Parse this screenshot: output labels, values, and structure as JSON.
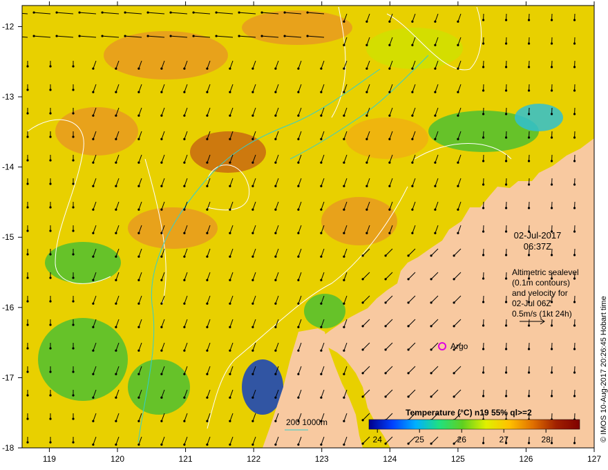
{
  "map": {
    "lon_range": [
      118.6,
      127.0
    ],
    "lat_range": [
      -18.0,
      -11.7
    ],
    "lon_ticks": [
      "119",
      "120",
      "121",
      "122",
      "123",
      "124",
      "125",
      "126",
      "127"
    ],
    "lat_ticks": [
      "-12",
      "-13",
      "-14",
      "-15",
      "-16",
      "-17",
      "-18"
    ],
    "colors": {
      "land": "#f8c9a0",
      "ocean_warm": "#e89a20",
      "ocean_mid": "#f0e000",
      "ocean_cool": "#4fbf30",
      "coast_cold": "#1040c0",
      "contour": "#ffffff",
      "isobath": "#30d0d0",
      "arrow": "#000000",
      "argo_marker": "#e000e0"
    }
  },
  "annotations": {
    "date": "02-Jul-2017",
    "time": "06:37Z",
    "info_lines": [
      "Altimetric sealevel",
      "(0.1m contours)",
      "and velocity for",
      "02-Jul 06Z",
      "0.5m/s (1kt 24h)"
    ],
    "argo_label": "Argo",
    "isobath_label": "200  1000m",
    "credit": "© IMOS 10-Aug-2017 20:26:45 Hobart time"
  },
  "legend": {
    "title": "Temperature (°C) n19 55% ql>=2",
    "ticks": [
      "24",
      "25",
      "26",
      "27",
      "28"
    ],
    "range": [
      23.8,
      28.8
    ],
    "gradient": [
      "#00008b",
      "#0040ff",
      "#00b0ff",
      "#20e080",
      "#60d020",
      "#e0f000",
      "#ffc000",
      "#e07000",
      "#a02000",
      "#800000"
    ]
  }
}
